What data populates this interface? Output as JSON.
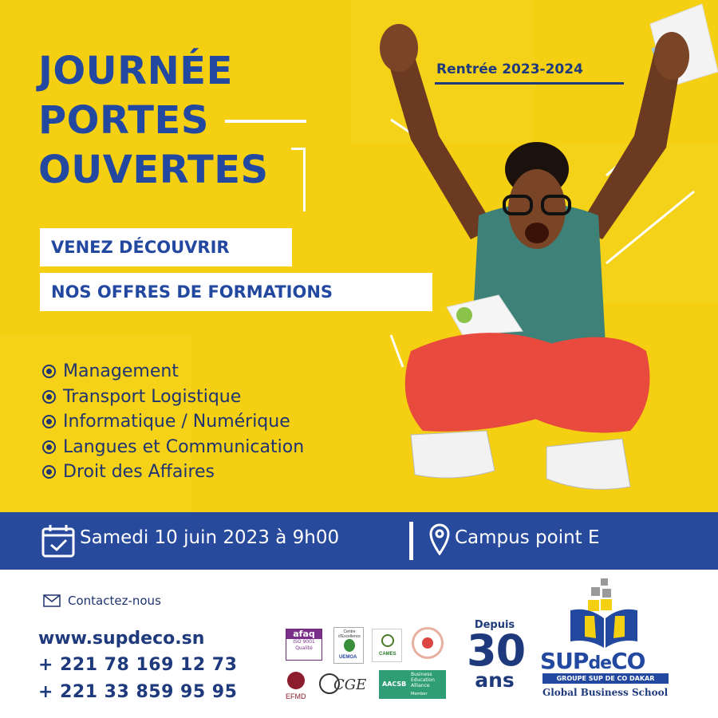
{
  "hero": {
    "title_lines": [
      "JOURNÉE",
      "PORTES",
      "OUVERTES"
    ],
    "rentree": "Rentrée 2023-2024",
    "pill_1": "VENEZ DÉCOUVRIR",
    "pill_2": "NOS OFFRES DE FORMATIONS",
    "courses": [
      "Management",
      "Transport Logistique",
      "Informatique / Numérique",
      "Langues et Communication",
      "Droit des Affaires"
    ]
  },
  "event": {
    "date": "Samedi 10 juin 2023 à 9h00",
    "location": "Campus point E"
  },
  "contact": {
    "label": "Contactez-nous",
    "website": "www.supdeco.sn",
    "phone_1": "+ 221 78 169 12 73",
    "phone_2": "+ 221 33 859 95 95"
  },
  "accreditations": {
    "afaq": "afaq",
    "afaq_iso": "ISO 9001",
    "afaq_sub": "Qualité",
    "excellence": "Centre d'Excellence",
    "uemoa": "UEMOA",
    "cames": "CAMES",
    "efmd": "EFMD",
    "cge": "CGE",
    "aacsb": "AACSB",
    "aacsb_sub": "Business Education Alliance",
    "aacsb_member": "Member"
  },
  "since": {
    "label": "Depuis",
    "number": "30",
    "unit": "ans"
  },
  "brand": {
    "name_main": "SUP",
    "name_mid": "de",
    "name_end": "CO",
    "group": "GROUPE SUP DE CO DAKAR",
    "tagline": "Global Business School"
  },
  "colors": {
    "yellow": "#f4cf12",
    "blue": "#284a9c",
    "dark_blue": "#1f3a7c",
    "title_blue": "#2348a0"
  }
}
